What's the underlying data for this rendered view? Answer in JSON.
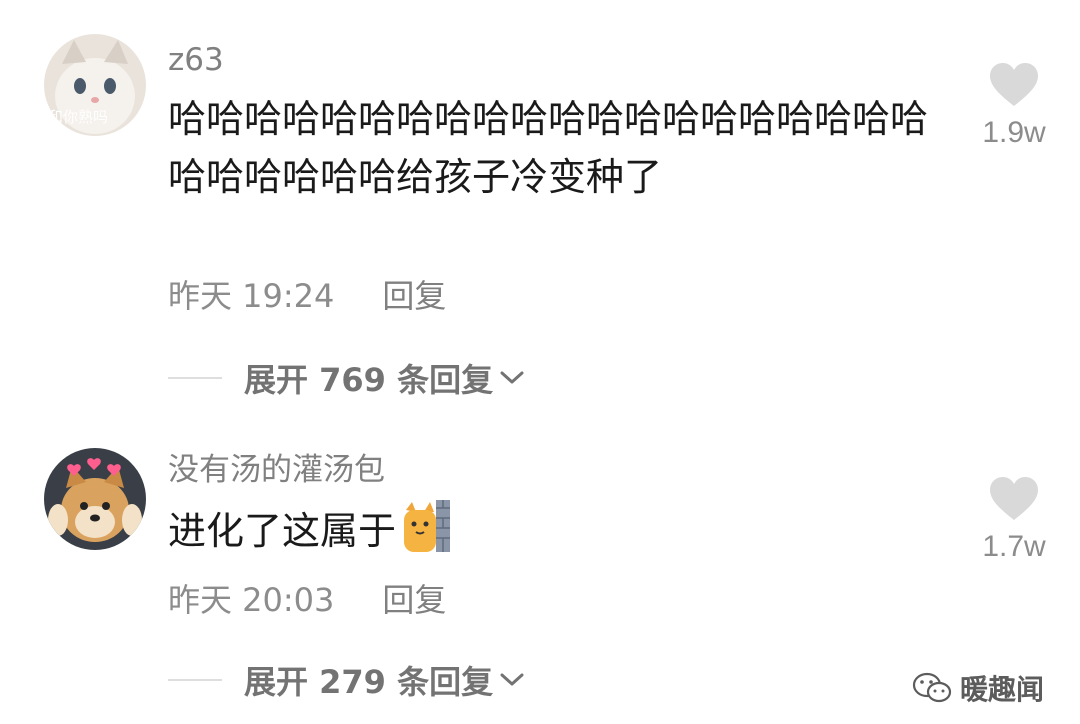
{
  "comments": [
    {
      "username": "z63",
      "text": "哈哈哈哈哈哈哈哈哈哈哈哈哈哈哈哈哈哈哈哈哈哈哈哈哈哈给孩子冷变种了",
      "date": "昨天 19:24",
      "reply_label": "回复",
      "likes": "1.9w",
      "expand_label": "展开 769 条回复",
      "avatar_icon": "cat-meme-avatar",
      "avatar_caption": "和你熟吗"
    },
    {
      "username": "没有汤的灌汤包",
      "text": "进化了这属于",
      "date": "昨天 20:03",
      "reply_label": "回复",
      "likes": "1.7w",
      "expand_label": "展开 279 条回复",
      "avatar_icon": "shiba-dog-avatar",
      "emoji": "cat-at-wall-emoji"
    }
  ],
  "watermark": {
    "text": "暖趣闻",
    "icon": "wechat-icon"
  },
  "colors": {
    "text": "#1a1a1a",
    "meta": "#8c8c8c",
    "like": "#d9d9d9"
  }
}
